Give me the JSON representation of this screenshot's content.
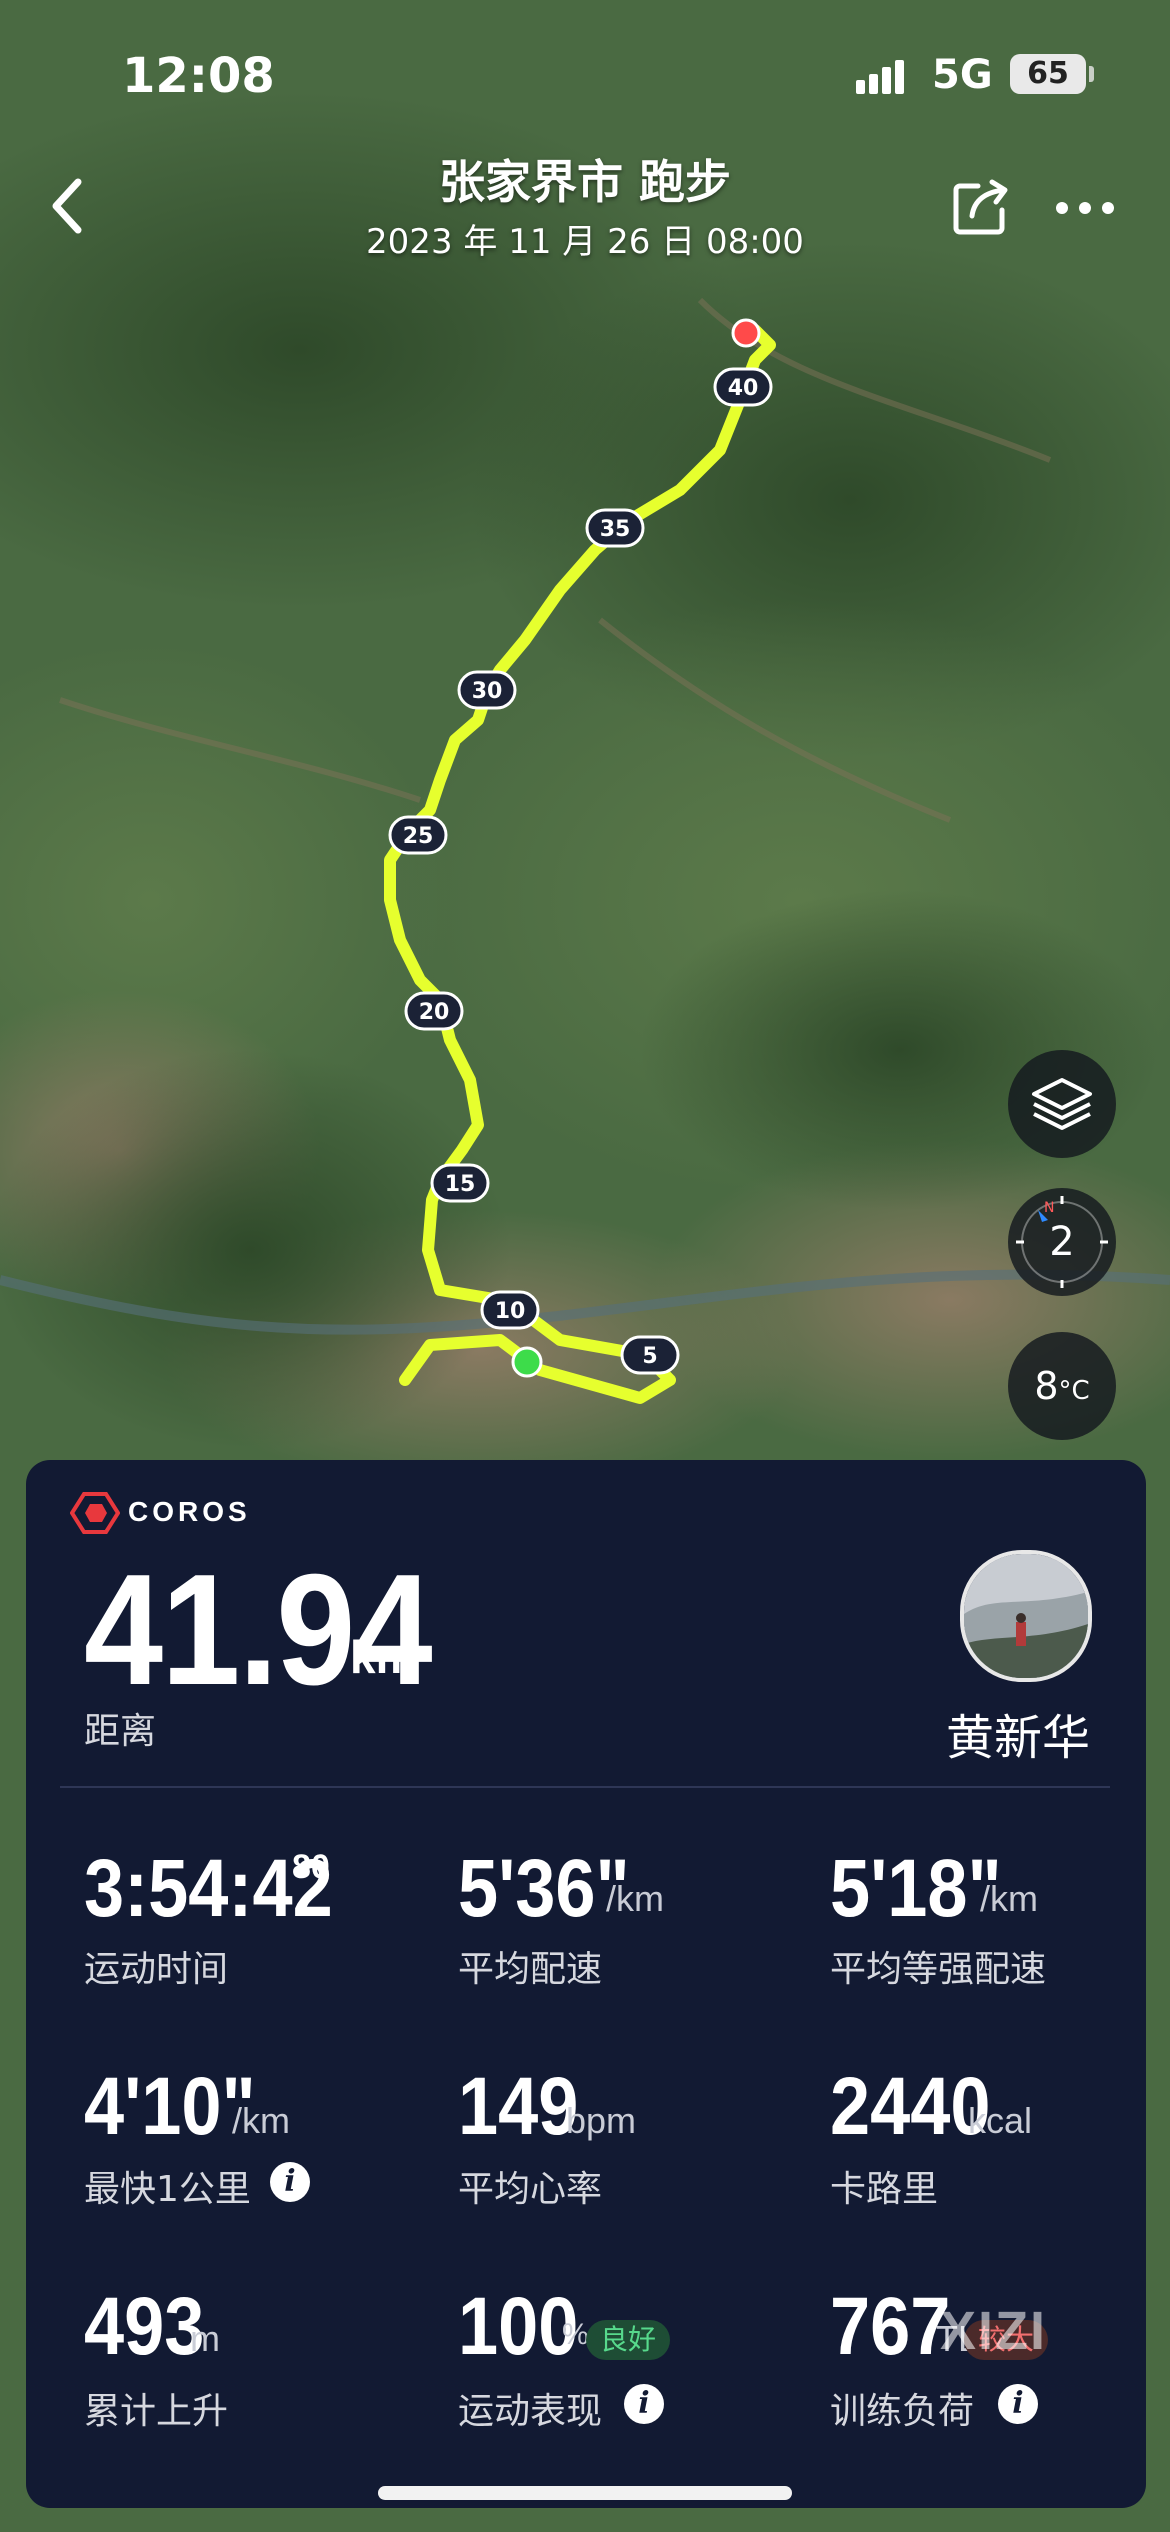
{
  "status_bar": {
    "time": "12:08",
    "network": "5G",
    "battery": "65"
  },
  "header": {
    "title": "张家界市 跑步",
    "datetime": "2023 年 11 月 26 日 08:00"
  },
  "map": {
    "route_color": "#e6ff2e",
    "start_marker_color": "#3ddc4a",
    "end_marker_color": "#ff4a4a",
    "km_markers": [
      "5",
      "10",
      "15",
      "20",
      "25",
      "30",
      "35",
      "40"
    ],
    "layers_icon": "layers-icon",
    "compass_value": "2",
    "compass_direction": "N",
    "temperature": "8",
    "temperature_unit": "°C"
  },
  "panel": {
    "brand": "COROS",
    "distance": {
      "value": "41.94",
      "unit": "km",
      "label": "距离"
    },
    "user": {
      "name": "黄新华"
    },
    "stats": {
      "duration": {
        "value": "3:54:42",
        "sup": "80",
        "label": "运动时间"
      },
      "avg_pace": {
        "value": "5'36\"",
        "unit": "/km",
        "label": "平均配速"
      },
      "grade_adjusted_pace": {
        "value": "5'18\"",
        "unit": "/km",
        "label": "平均等强配速"
      },
      "fastest_km": {
        "value": "4'10\"",
        "unit": "/km",
        "label": "最快1公里"
      },
      "avg_hr": {
        "value": "149",
        "unit": "bpm",
        "label": "平均心率"
      },
      "calories": {
        "value": "2440",
        "unit": "kcal",
        "label": "卡路里"
      },
      "ascent": {
        "value": "493",
        "unit": "m",
        "label": "累计上升"
      },
      "performance": {
        "value": "100",
        "unit": "%",
        "badge": "良好",
        "label": "运动表现"
      },
      "training_load": {
        "value": "767",
        "unit": "TL",
        "badge": "较大",
        "label": "训练负荷"
      }
    }
  },
  "watermark": "XIZI"
}
